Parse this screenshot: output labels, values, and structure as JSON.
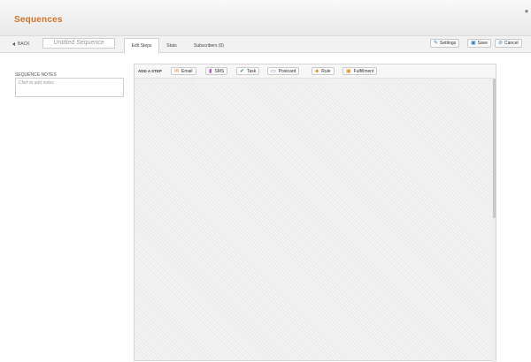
{
  "header": {
    "title": "Sequences"
  },
  "toolbar": {
    "back_label": "BACK",
    "sequence_name": "Untitled Sequence",
    "tabs": [
      {
        "label": "Edit Steps",
        "active": true
      },
      {
        "label": "Stats",
        "active": false
      },
      {
        "label": "Subscribers (0)",
        "active": false
      }
    ],
    "actions": [
      {
        "label": "Settings",
        "icon": "wrench-icon"
      },
      {
        "label": "Save",
        "icon": "save-icon"
      },
      {
        "label": "Cancel",
        "icon": "cancel-icon"
      }
    ]
  },
  "notes": {
    "label": "SEQUENCE NOTES",
    "placeholder": "Click to add notes"
  },
  "steps": {
    "add_label": "ADD A STEP",
    "buttons": [
      {
        "label": "Email",
        "icon": "email-icon",
        "color": "#e58b4c"
      },
      {
        "label": "SMS",
        "icon": "sms-icon",
        "color": "#b050c0"
      },
      {
        "label": "Task",
        "icon": "check-icon",
        "color": "#3a9a3a"
      },
      {
        "label": "Postcard",
        "icon": "postcard-icon",
        "color": "#2e78b8"
      },
      {
        "label": "Rule",
        "icon": "rule-icon",
        "color": "#e0962b"
      },
      {
        "label": "Fulfillment",
        "icon": "fulfillment-icon",
        "color": "#e0962b"
      }
    ]
  },
  "colors": {
    "accent": "#d0732b"
  }
}
